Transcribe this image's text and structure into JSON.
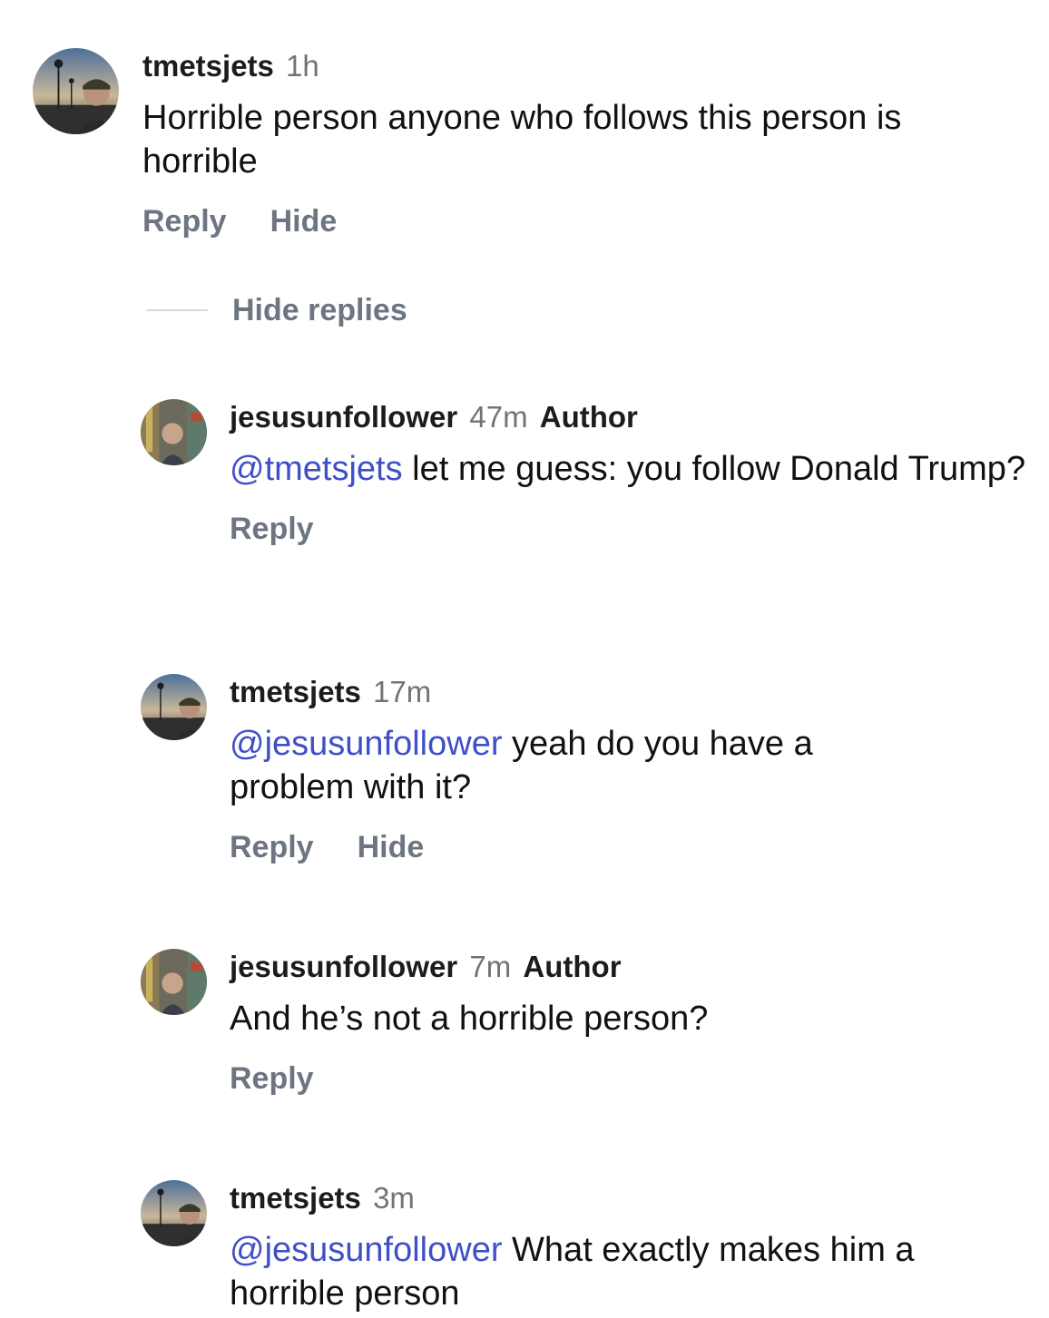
{
  "colors": {
    "mention": "#3f4fc8",
    "action": "#6e7582",
    "timestamp": "#737373"
  },
  "thread": {
    "top_comment": {
      "username": "tmetsjets",
      "time": "1h",
      "text": "Horrible person anyone who follows this person is horrible",
      "reply_label": "Reply",
      "hide_label": "Hide"
    },
    "hide_replies_label": "Hide replies",
    "replies": [
      {
        "username": "jesusunfollower",
        "time": "47m",
        "badge": "Author",
        "mention": "@tmetsjets",
        "text": " let me guess: you follow Donald Trump?",
        "reply_label": "Reply"
      },
      {
        "username": "tmetsjets",
        "time": "17m",
        "mention": "@jesusunfollower",
        "text": " yeah do you have a problem with it?",
        "reply_label": "Reply",
        "hide_label": "Hide"
      },
      {
        "username": "jesusunfollower",
        "time": "7m",
        "badge": "Author",
        "text": "And he’s not a horrible person?",
        "reply_label": "Reply"
      },
      {
        "username": "tmetsjets",
        "time": "3m",
        "mention": "@jesusunfollower",
        "text": " What exactly makes him a horrible person"
      }
    ]
  }
}
